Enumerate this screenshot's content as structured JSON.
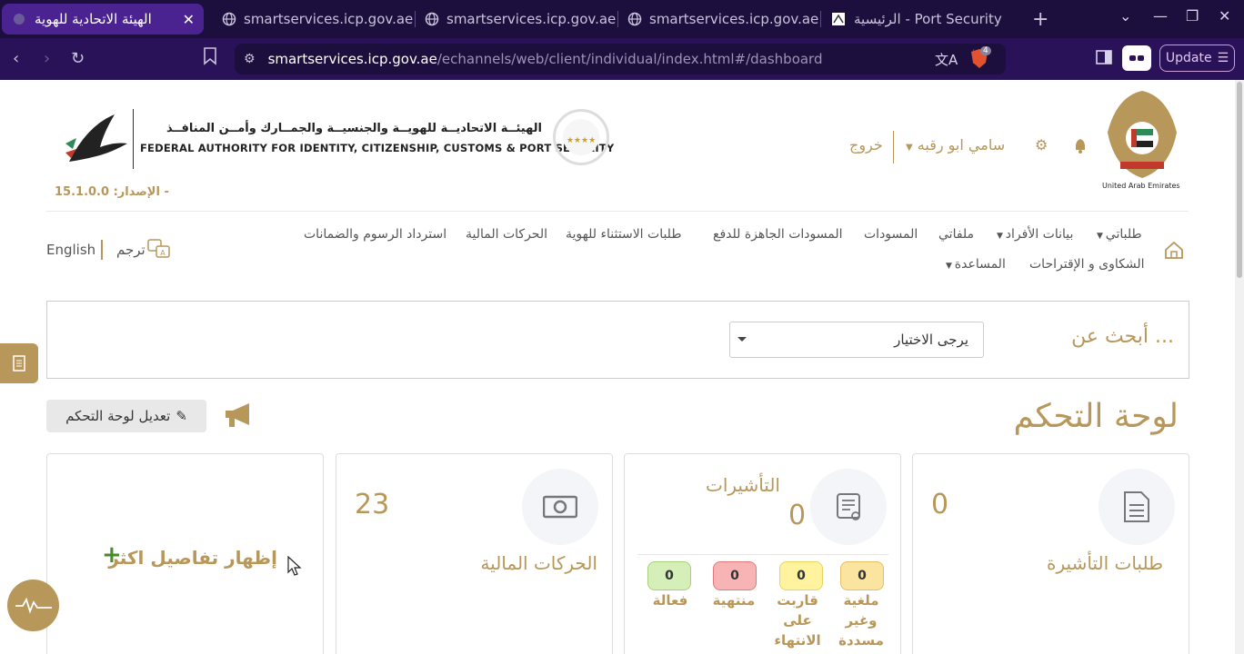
{
  "browser": {
    "tabs": [
      {
        "title": "الهيئة الاتحادية للهوية",
        "active": true,
        "close": "✕"
      },
      {
        "title": "smartservices.icp.gov.ae",
        "active": false
      },
      {
        "title": "smartservices.icp.gov.ae",
        "active": false
      },
      {
        "title": "smartservices.icp.gov.ae",
        "active": false
      },
      {
        "title": "الرئيسية - Port Security",
        "active": false
      }
    ],
    "new_tab": "+",
    "url_host": "smartservices.icp.gov.ae",
    "url_path": "/echannels/web/client/individual/index.html#/dashboard",
    "update_label": "Update",
    "brave_badge": "4"
  },
  "header": {
    "logo_ar": "الهيئــة الاتحاديــة للهويــة والجنسيــة والجمــارك وأمــن المنافــذ",
    "logo_en": "FEDERAL AUTHORITY FOR IDENTITY, CITIZENSHIP, CUSTOMS & PORT SECURITY",
    "version": "الإصدار: 15.1.0.0 -",
    "user_name": "سامي ابو رقبه",
    "logout": "خروج",
    "uae_label": "United Arab Emirates"
  },
  "menu": {
    "row1": [
      "طلباتي",
      "بيانات الأفراد",
      "ملفاتي",
      "المسودات",
      "المسودات الجاهزة للدفع",
      "طلبات الاستثناء للهوية",
      "الحركات المالية",
      "استرداد الرسوم والضمانات"
    ],
    "row2": [
      "الشكاوى و الإقتراحات",
      "المساعدة"
    ],
    "translate": "ترجم",
    "english": "English"
  },
  "search": {
    "label": "أبحث عن ...",
    "select_value": "يرجى الاختيار"
  },
  "dashboard": {
    "title": "لوحة التحكم",
    "edit_button": "تعديل لوحة التحكم",
    "cards": {
      "visa_requests": {
        "label": "طلبات التأشيرة",
        "value": "0"
      },
      "visas": {
        "label": "التأشيرات",
        "value": "0",
        "badges": [
          {
            "value": "0",
            "label": "ملغية وغير مسددة",
            "color": "#fbe3a0"
          },
          {
            "value": "0",
            "label": "قاربت على الانتهاء",
            "color": "#fff3a0"
          },
          {
            "value": "0",
            "label": "منتهية",
            "color": "#f8b4b4"
          },
          {
            "value": "0",
            "label": "فعالة",
            "color": "#d6eeb8"
          }
        ]
      },
      "financial": {
        "label": "الحركات المالية",
        "value": "23"
      },
      "more": {
        "label": "إظهار تفاصيل اكثر",
        "plus": "+"
      }
    }
  },
  "colors": {
    "gold": "#b8975a",
    "tab_bg": "#1d0f3d",
    "addr_bg": "#2a1259"
  }
}
